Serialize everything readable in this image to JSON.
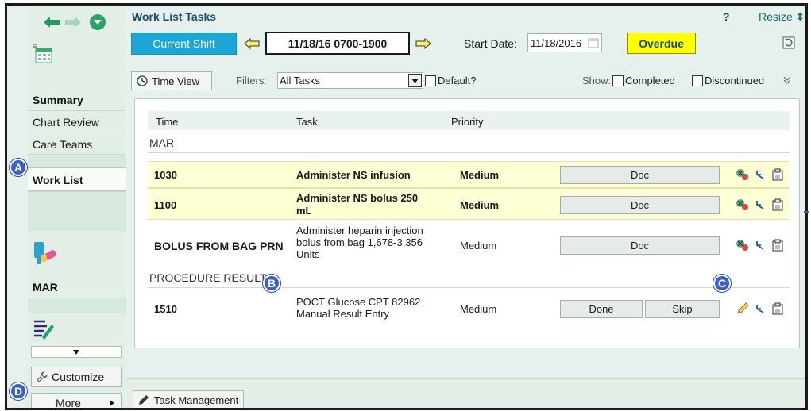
{
  "sidebar": {
    "summary_label": "Summary",
    "chart_review_label": "Chart Review",
    "care_teams_label": "Care Teams",
    "work_list_label": "Work List",
    "mar_label": "MAR",
    "customize_label": "Customize",
    "more_label": "More"
  },
  "header": {
    "title": "Work List Tasks",
    "help": "?",
    "resize": "Resize ⬍"
  },
  "toolbar": {
    "current_shift": "Current Shift",
    "shift_range": "11/18/16 0700-1900",
    "start_date_label": "Start Date:",
    "start_date_value": "11/18/2016",
    "overdue": "Overdue",
    "time_view": "Time View",
    "filters_label": "Filters:",
    "filter_value": "All Tasks",
    "default_label": "Default?",
    "show_label": "Show:",
    "completed_label": "Completed",
    "discontinued_label": "Discontinued"
  },
  "table": {
    "headers": {
      "time": "Time",
      "task": "Task",
      "priority": "Priority"
    },
    "sections": {
      "mar": "MAR",
      "procedure": "PROCEDURE RESULT"
    },
    "rows": [
      {
        "time": "1030",
        "task": "Administer NS infusion",
        "priority": "Medium",
        "action": "Doc"
      },
      {
        "time": "1100",
        "task": "Administer NS bolus 250 mL",
        "priority": "Medium",
        "action": "Doc"
      },
      {
        "time": "BOLUS FROM BAG PRN",
        "task": "Administer heparin injection bolus from bag 1,678-3,356 Units",
        "priority": "Medium",
        "action": "Doc"
      },
      {
        "time": "1510",
        "task": "POCT Glucose CPT 82962 Manual Result Entry",
        "priority": "Medium",
        "action1": "Done",
        "action2": "Skip"
      }
    ]
  },
  "callouts": {
    "a": "A",
    "b": "B",
    "c": "C",
    "d": "D"
  },
  "footer": {
    "task_management": "Task Management"
  },
  "colors": {
    "accent": "#1aa7d8",
    "overdue": "#ffff00",
    "highlight_row": "#ffffd6",
    "callout": "#3c5fcf"
  }
}
